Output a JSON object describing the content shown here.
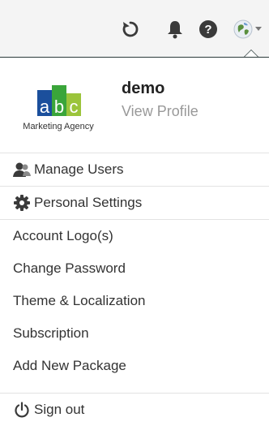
{
  "topbar": {
    "refresh_icon": "refresh-icon",
    "bell_icon": "bell-icon",
    "help_icon": "help-icon",
    "avatar_icon": "avatar-globe-icon"
  },
  "profile": {
    "logo_text": "abc",
    "logo_caption": "Marketing Agency",
    "username": "demo",
    "view_profile": "View Profile"
  },
  "menu": {
    "manage_users": "Manage Users",
    "personal_settings": "Personal Settings",
    "account_logo": "Account Logo(s)",
    "change_password": "Change Password",
    "theme_localization": "Theme & Localization",
    "subscription": "Subscription",
    "add_package": "Add New Package",
    "sign_out": "Sign out"
  },
  "colors": {
    "logo_a": "#1b4f9c",
    "logo_b": "#3aa53a",
    "logo_c": "#9bc43b",
    "icon": "#3a3a3a",
    "text": "#333333",
    "muted": "#999999"
  }
}
